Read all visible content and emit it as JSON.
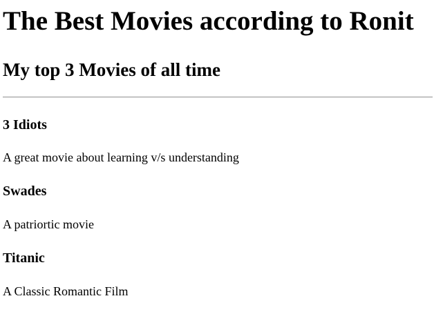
{
  "page": {
    "heading": "The Best Movies according to Ronit",
    "subheading": "My top 3 Movies of all time"
  },
  "movies": [
    {
      "title": "3 Idiots",
      "description": "A great movie about learning v/s understanding"
    },
    {
      "title": "Swades",
      "description": "A patriortic movie"
    },
    {
      "title": "Titanic",
      "description": "A Classic Romantic Film"
    }
  ]
}
